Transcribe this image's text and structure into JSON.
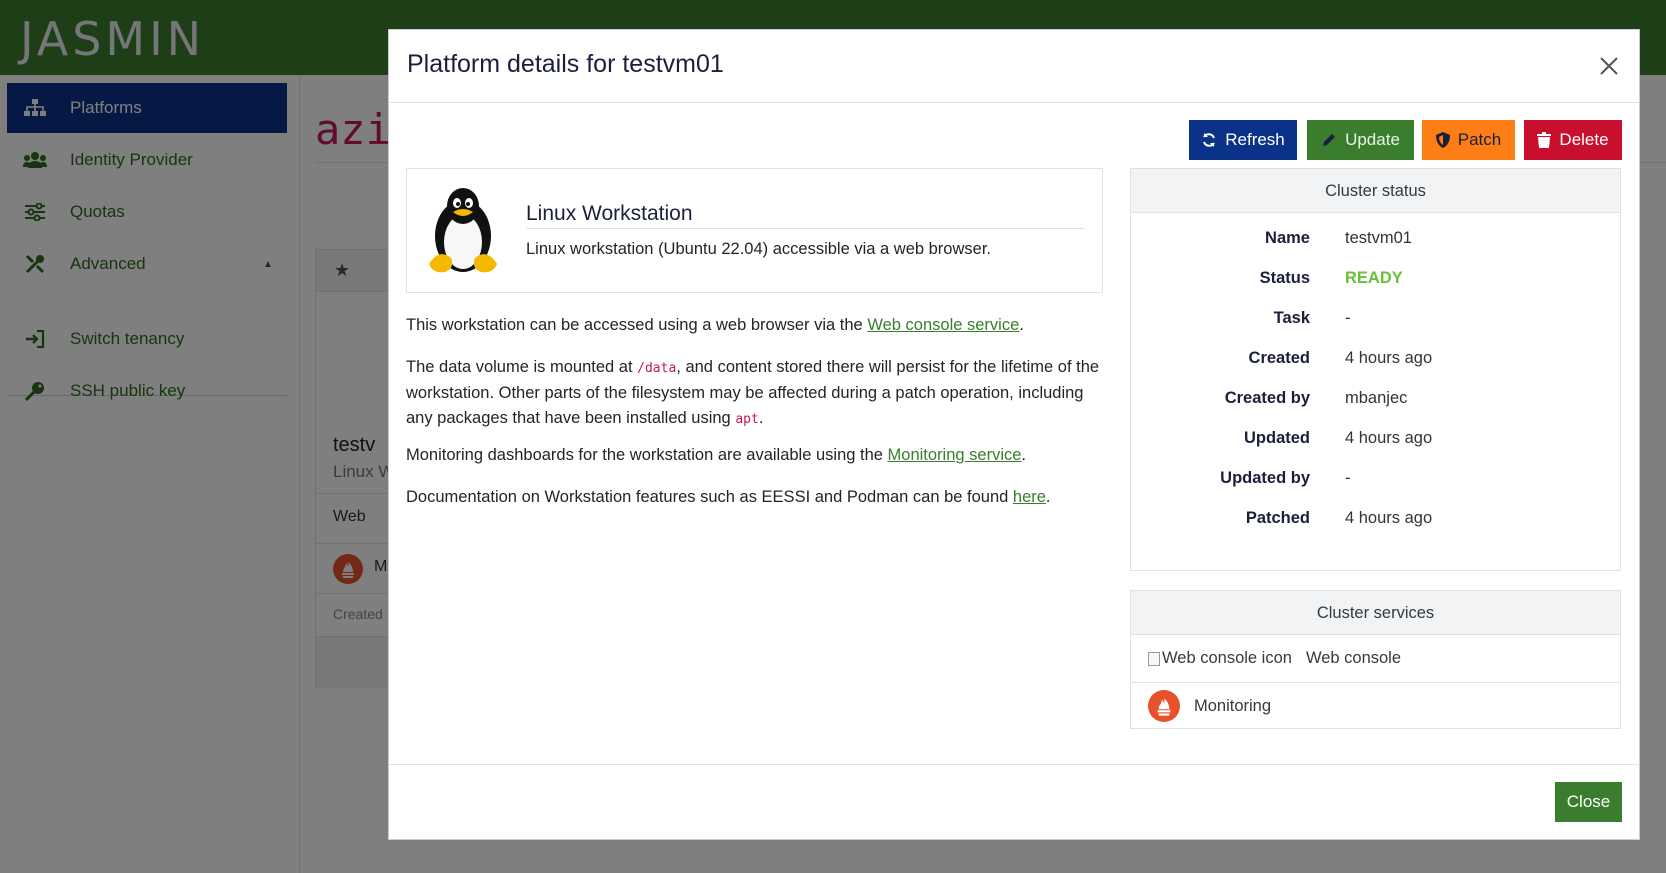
{
  "app": {
    "logo": "JASMIN",
    "brand_color": "#3a7d2e",
    "accent_color": "#0a3289"
  },
  "sidebar": {
    "items": [
      {
        "label": "Platforms",
        "icon": "sitemap-icon",
        "active": true
      },
      {
        "label": "Identity Provider",
        "icon": "users-icon"
      },
      {
        "label": "Quotas",
        "icon": "sliders-icon"
      },
      {
        "label": "Advanced",
        "icon": "tools-icon",
        "has_caret": true
      },
      {
        "label": "Switch tenancy",
        "icon": "sign-in-icon"
      },
      {
        "label": "SSH public key",
        "icon": "key-icon"
      }
    ]
  },
  "background": {
    "heading": "azi",
    "card": {
      "title": "testv",
      "subtitle": "Linux W",
      "row_web": "Web",
      "row_mon": "M",
      "row_created": "Created"
    }
  },
  "modal": {
    "title": "Platform details for testvm01",
    "actions": {
      "refresh": "Refresh",
      "update": "Update",
      "patch": "Patch",
      "delete": "Delete"
    },
    "app": {
      "title": "Linux Workstation",
      "description": "Linux workstation (Ubuntu 22.04) accessible via a web browser."
    },
    "paragraphs": {
      "p1_pre": "This workstation can be accessed using a web browser via the ",
      "p1_link": "Web console service",
      "p1_post": ".",
      "p2_a": "The data volume is mounted at ",
      "p2_code1": "/data",
      "p2_b": ", and content stored there will persist for the lifetime of the workstation. Other parts of the filesystem may be affected during a patch operation, including any packages that have been installed using ",
      "p2_code2": "apt",
      "p2_c": ".",
      "p3_pre": "Monitoring dashboards for the workstation are available using the ",
      "p3_link": "Monitoring service",
      "p3_post": ".",
      "p4_pre": "Documentation on Workstation features such as EESSI and Podman can be found ",
      "p4_link": "here",
      "p4_post": "."
    },
    "cluster_status": {
      "header": "Cluster status",
      "rows": [
        {
          "key": "Name",
          "value": "testvm01"
        },
        {
          "key": "Status",
          "value": "READY"
        },
        {
          "key": "Task",
          "value": "-"
        },
        {
          "key": "Created",
          "value": "4 hours ago"
        },
        {
          "key": "Created by",
          "value": "mbanjec"
        },
        {
          "key": "Updated",
          "value": "4 hours ago"
        },
        {
          "key": "Updated by",
          "value": "-"
        },
        {
          "key": "Patched",
          "value": "4 hours ago"
        }
      ]
    },
    "cluster_services": {
      "header": "Cluster services",
      "services": [
        {
          "alt": "Web console icon",
          "label": "Web console"
        },
        {
          "label": "Monitoring",
          "icon": "prometheus-icon"
        }
      ]
    },
    "close_label": "Close"
  }
}
